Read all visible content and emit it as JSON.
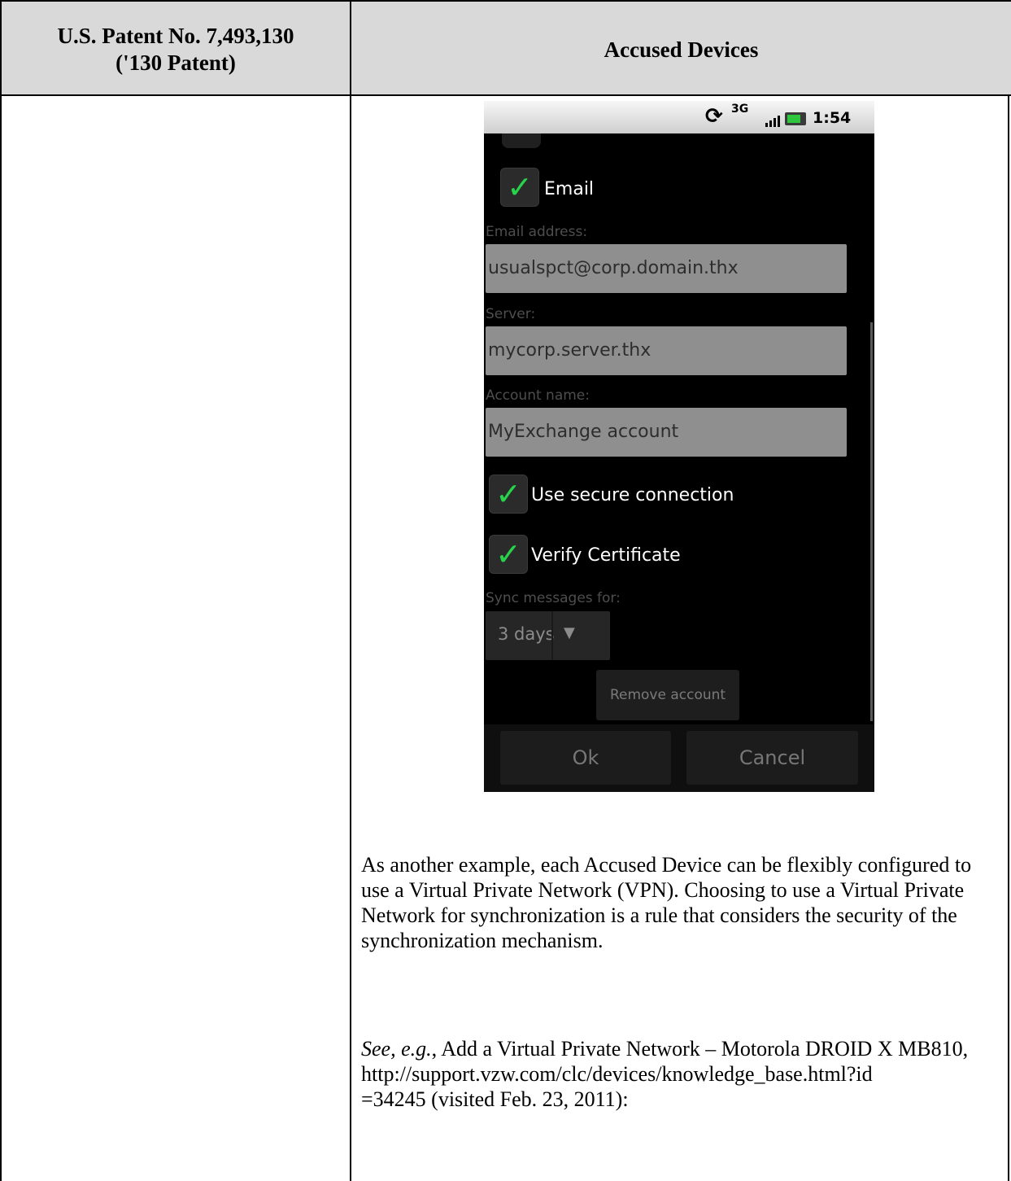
{
  "header": {
    "left_title_line1": "U.S. Patent No. 7,493,130",
    "left_title_line2": "('130 Patent)",
    "right_title": "Accused Devices"
  },
  "phone": {
    "status": {
      "network": "3G",
      "time": "1:54"
    },
    "email_toggle_label": "Email",
    "email_label": "Email address:",
    "email_value": "usualspct@corp.domain.thx",
    "server_label": "Server:",
    "server_value": "mycorp.server.thx",
    "account_label": "Account name:",
    "account_value": "MyExchange account",
    "secure_label": "Use secure connection",
    "verify_label": "Verify Certificate",
    "sync_label": "Sync messages for:",
    "sync_value": "3 days",
    "remove_label": "Remove account",
    "ok_label": "Ok",
    "cancel_label": "Cancel"
  },
  "body": {
    "para1": "As another example, each Accused Device can be flexibly configured to use a Virtual Private Network (VPN). Choosing to use a Virtual Private Network for synchronization is a rule that considers the security of the synchronization mechanism.",
    "see_italic": "See, e.g.",
    "see_rest": ", Add a Virtual Private Network – Motorola DROID X MB810,",
    "url_line1": "http://support.vzw.com/clc/devices/knowledge_base.html?id",
    "url_line2": "=34245 (visited Feb. 23, 2011):"
  }
}
